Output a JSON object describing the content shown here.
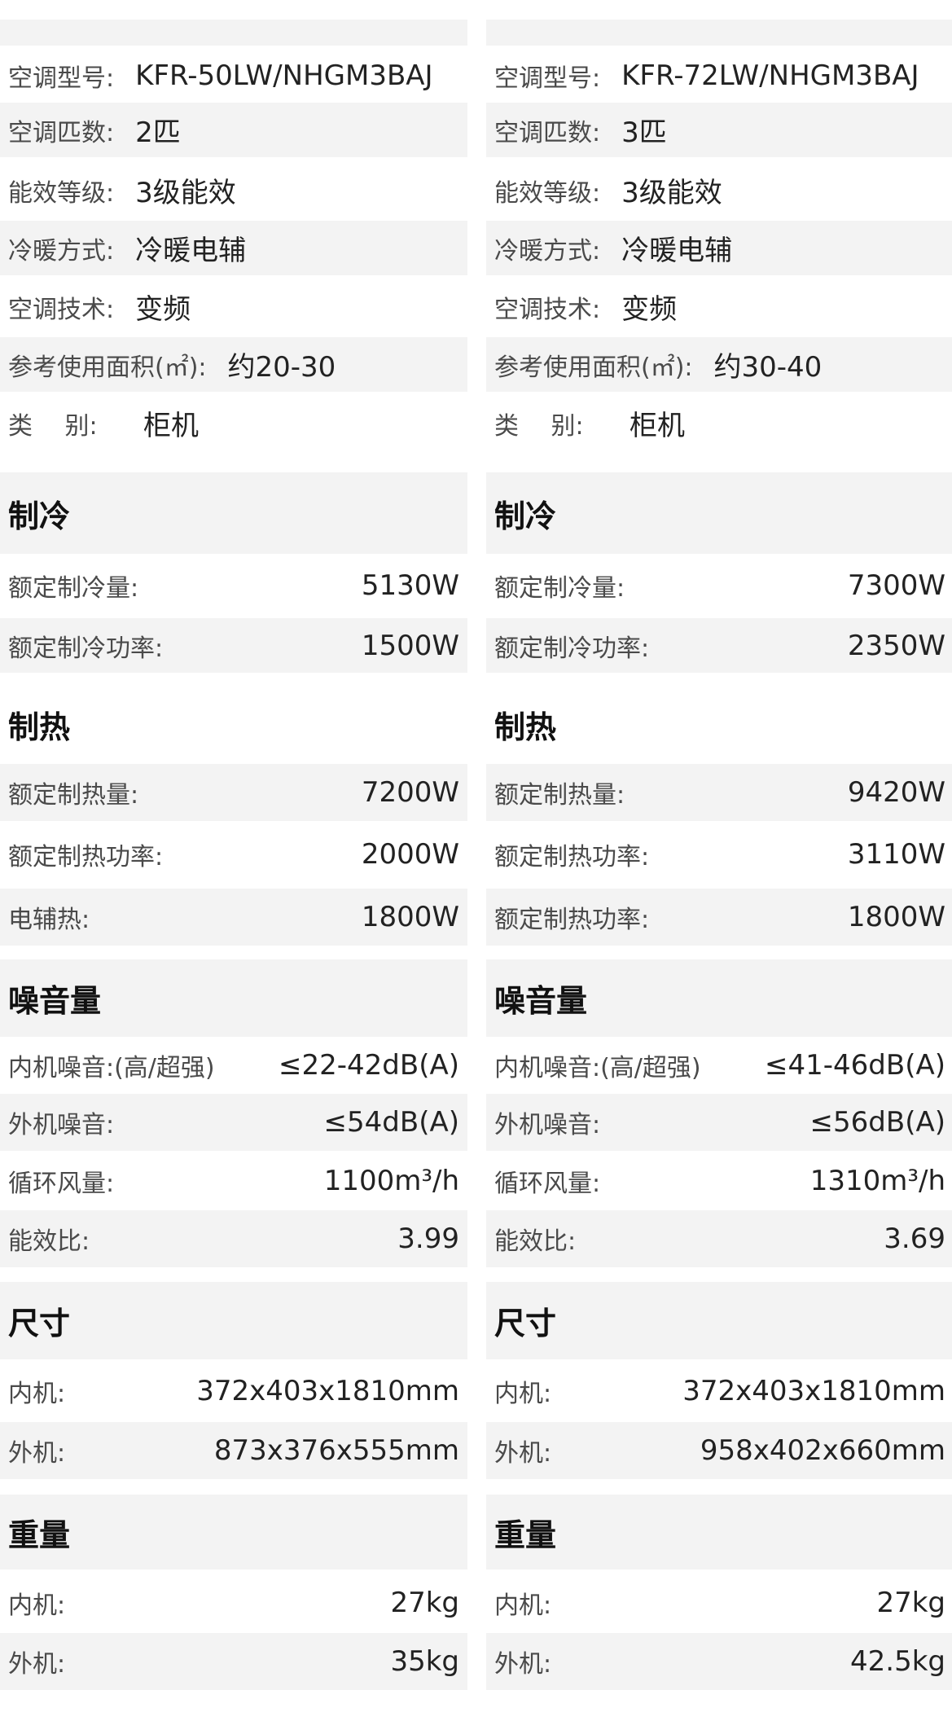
{
  "left": {
    "basic": [
      {
        "label": "空调型号:",
        "value": "KFR-50LW/NHGM3BAJ"
      },
      {
        "label": "空调匹数:",
        "value": "2匹"
      },
      {
        "label": "能效等级:",
        "value": "3级能效"
      },
      {
        "label": "冷暖方式:",
        "value": "冷暖电辅"
      },
      {
        "label": "空调技术:",
        "value": "变频"
      },
      {
        "label": "参考使用面积(㎡):",
        "value": "约20-30"
      },
      {
        "label": "类　 别:",
        "value": "柜机"
      }
    ],
    "cool": {
      "title": "制冷",
      "rows": [
        {
          "label": "额定制冷量:",
          "value": "5130W"
        },
        {
          "label": "额定制冷功率:",
          "value": "1500W"
        }
      ]
    },
    "heat": {
      "title": "制热",
      "rows": [
        {
          "label": "额定制热量:",
          "value": "7200W"
        },
        {
          "label": "额定制热功率:",
          "value": "2000W"
        },
        {
          "label": "电辅热:",
          "value": "1800W"
        }
      ]
    },
    "noise": {
      "title": "噪音量",
      "rows": [
        {
          "label": "内机噪音:(高/超强)",
          "value": "≤22-42dB(A)"
        },
        {
          "label": "外机噪音:",
          "value": "≤54dB(A)"
        },
        {
          "label": "循环风量:",
          "value": "1100m³/h"
        },
        {
          "label": "能效比:",
          "value": "3.99"
        }
      ]
    },
    "size": {
      "title": "尺寸",
      "rows": [
        {
          "label": "内机:",
          "value": "372x403x1810mm"
        },
        {
          "label": "外机:",
          "value": "873x376x555mm"
        }
      ]
    },
    "weight": {
      "title": "重量",
      "rows": [
        {
          "label": "内机:",
          "value": "27kg"
        },
        {
          "label": "外机:",
          "value": "35kg"
        }
      ]
    }
  },
  "right": {
    "basic": [
      {
        "label": "空调型号:",
        "value": "KFR-72LW/NHGM3BAJ"
      },
      {
        "label": "空调匹数:",
        "value": "3匹"
      },
      {
        "label": "能效等级:",
        "value": "3级能效"
      },
      {
        "label": "冷暖方式:",
        "value": "冷暖电辅"
      },
      {
        "label": "空调技术:",
        "value": "变频"
      },
      {
        "label": "参考使用面积(㎡):",
        "value": "约30-40"
      },
      {
        "label": "类　 别:",
        "value": "柜机"
      }
    ],
    "cool": {
      "title": "制冷",
      "rows": [
        {
          "label": "额定制冷量:",
          "value": "7300W"
        },
        {
          "label": "额定制冷功率:",
          "value": "2350W"
        }
      ]
    },
    "heat": {
      "title": "制热",
      "rows": [
        {
          "label": "额定制热量:",
          "value": "9420W"
        },
        {
          "label": "额定制热功率:",
          "value": "3110W"
        },
        {
          "label": "额定制热功率:",
          "value": "1800W"
        }
      ]
    },
    "noise": {
      "title": "噪音量",
      "rows": [
        {
          "label": "内机噪音:(高/超强)",
          "value": "≤41-46dB(A)"
        },
        {
          "label": "外机噪音:",
          "value": "≤56dB(A)"
        },
        {
          "label": "循环风量:",
          "value": "1310m³/h"
        },
        {
          "label": "能效比:",
          "value": "3.69"
        }
      ]
    },
    "size": {
      "title": "尺寸",
      "rows": [
        {
          "label": "内机:",
          "value": "372x403x1810mm"
        },
        {
          "label": "外机:",
          "value": "958x402x660mm"
        }
      ]
    },
    "weight": {
      "title": "重量",
      "rows": [
        {
          "label": "内机:",
          "value": "27kg"
        },
        {
          "label": "外机:",
          "value": "42.5kg"
        }
      ]
    }
  }
}
